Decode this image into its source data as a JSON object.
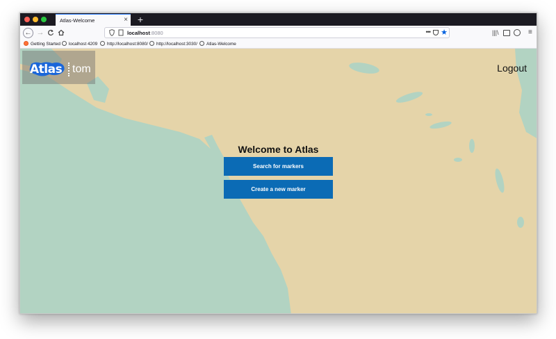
{
  "browser": {
    "tab": {
      "title": "Atlas-Welcome",
      "close": "×"
    },
    "new_tab": "+",
    "toolbar": {
      "back": "←",
      "forward": "→",
      "reload": "C",
      "home": "⌂",
      "url_host": "localhost",
      "url_port": ":8080",
      "page_actions": "•••",
      "bookmark_star": "★",
      "library": "|||\\",
      "menu": "≡"
    },
    "bookmarks": [
      {
        "label": "Getting Started",
        "icon": "firefox-icon"
      },
      {
        "label": "localhost 4209",
        "icon": "globe-icon"
      },
      {
        "label": "http://localhost:8080/",
        "icon": "globe-icon"
      },
      {
        "label": "http://localhost:3030/",
        "icon": "globe-icon"
      },
      {
        "label": "Atlas-Welcome",
        "icon": "globe-icon"
      }
    ]
  },
  "app": {
    "logo_text": "Atlas",
    "username": "tom",
    "logout_label": "Logout",
    "welcome_title": "Welcome to Atlas",
    "search_button": "Search for markers",
    "create_button": "Create a new marker"
  },
  "colors": {
    "land": "#e5d4a9",
    "water": "#b2d3c2",
    "primary_button": "#0b6bb5",
    "tab_accent": "#2f80ff"
  }
}
